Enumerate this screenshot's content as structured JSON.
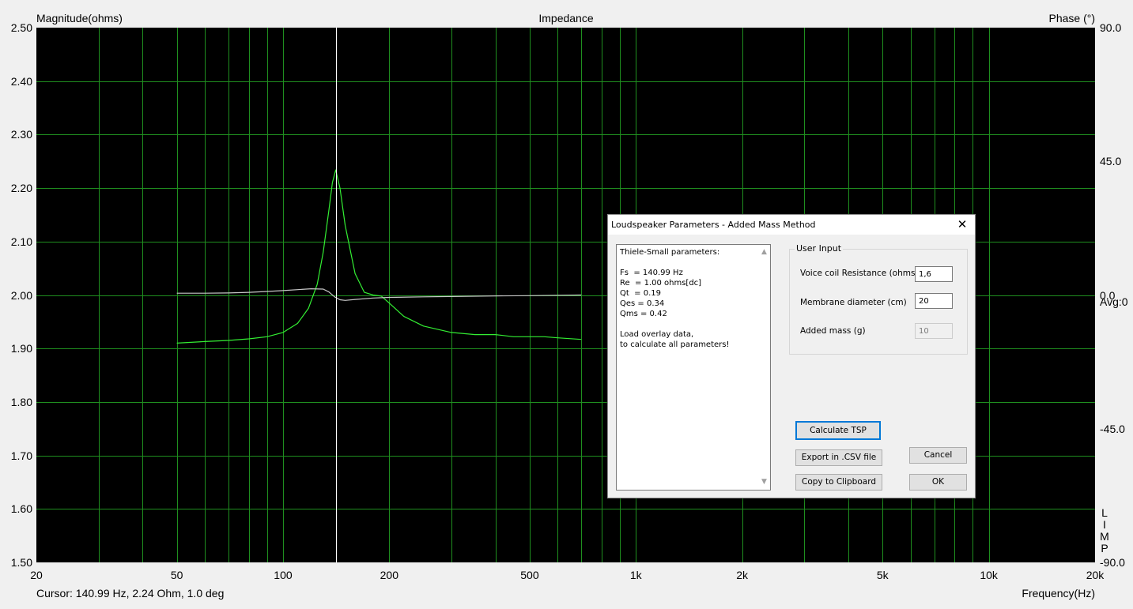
{
  "plot": {
    "title": "Impedance",
    "left_axis_label": "Magnitude(ohms)",
    "right_axis_label": "Phase (°)",
    "x_axis_label": "Frequency(Hz)",
    "cursor_readout": "Cursor: 140.99 Hz, 2.24 Ohm, 1.0 deg",
    "avg_label": "Avg:0",
    "side_letters": [
      "L",
      "I",
      "M",
      "P"
    ],
    "colors": {
      "background": "#000000",
      "grid": "#1f8f1f",
      "magnitude_trace": "#33ee33",
      "phase_trace": "#c8c8c8",
      "cursor": "#ffffff"
    }
  },
  "chart_data": {
    "type": "line",
    "title": "Impedance",
    "xlabel": "Frequency(Hz)",
    "ylabel": "Magnitude(ohms)",
    "y2label": "Phase (°)",
    "x_scale": "log",
    "xlim": [
      20,
      20000
    ],
    "ylim": [
      1.5,
      2.5
    ],
    "y2lim": [
      -90,
      90
    ],
    "grid": true,
    "x_ticks": [
      "20",
      "50",
      "100",
      "200",
      "500",
      "1k",
      "2k",
      "5k",
      "10k",
      "20k"
    ],
    "x_tick_values": [
      20,
      50,
      100,
      200,
      500,
      1000,
      2000,
      5000,
      10000,
      20000
    ],
    "y_ticks": [
      "2.50",
      "2.40",
      "2.30",
      "2.20",
      "2.10",
      "2.00",
      "1.90",
      "1.80",
      "1.70",
      "1.60",
      "1.50"
    ],
    "y_tick_values": [
      2.5,
      2.4,
      2.3,
      2.2,
      2.1,
      2.0,
      1.9,
      1.8,
      1.7,
      1.6,
      1.5
    ],
    "y2_ticks": [
      "90.0",
      "45.0",
      "0.0",
      "-45.0",
      "-90.0"
    ],
    "y2_tick_values": [
      90,
      45,
      0,
      -45,
      -90
    ],
    "cursor_x": 140.99,
    "series": [
      {
        "axis": "left",
        "x": [
          50,
          60,
          70,
          80,
          90,
          100,
          110,
          118,
          125,
          130,
          135,
          138,
          140.99,
          145,
          150,
          160,
          170,
          180,
          190,
          200,
          220,
          250,
          300,
          350,
          400,
          450,
          500,
          550,
          600,
          700
        ],
        "values": [
          1.91,
          1.913,
          1.915,
          1.918,
          1.922,
          1.93,
          1.947,
          1.975,
          2.02,
          2.08,
          2.16,
          2.21,
          2.234,
          2.2,
          2.13,
          2.04,
          2.005,
          2.0,
          1.998,
          1.985,
          1.96,
          1.942,
          1.93,
          1.926,
          1.926,
          1.922,
          1.922,
          1.922,
          1.92,
          1.917
        ]
      },
      {
        "axis": "right",
        "x": [
          50,
          60,
          70,
          80,
          90,
          100,
          110,
          120,
          130,
          135,
          140,
          145,
          150,
          160,
          180,
          200,
          250,
          300,
          400,
          500,
          700
        ],
        "values": [
          0.6,
          0.6,
          0.7,
          0.9,
          1.2,
          1.5,
          1.8,
          2.1,
          2.0,
          1.0,
          -0.6,
          -1.6,
          -1.8,
          -1.5,
          -1.0,
          -0.8,
          -0.6,
          -0.5,
          -0.3,
          -0.2,
          0.0
        ]
      }
    ]
  },
  "dialog": {
    "title": "Loudspeaker Parameters - Added Mass Method",
    "close_glyph": "✕",
    "tsp_lines": [
      "Thiele-Small parameters:",
      "",
      "Fs  = 140.99 Hz",
      "Re  = 1.00 ohms[dc]",
      "Qt  = 0.19",
      "Qes = 0.34",
      "Qms = 0.42",
      "",
      "Load overlay data,",
      "to calculate all parameters!"
    ],
    "scroll_up_glyph": "▲",
    "scroll_down_glyph": "▼",
    "user_input": {
      "legend": "User Input",
      "voice_coil_label": "Voice coil Resistance (ohms)",
      "voice_coil_value": "1,6",
      "diameter_label": "Membrane diameter (cm)",
      "diameter_value": "20",
      "added_mass_label": "Added mass (g)",
      "added_mass_value": "10"
    },
    "buttons": {
      "calculate": "Calculate TSP",
      "export": "Export in .CSV file",
      "copy": "Copy to Clipboard",
      "cancel": "Cancel",
      "ok": "OK"
    }
  }
}
